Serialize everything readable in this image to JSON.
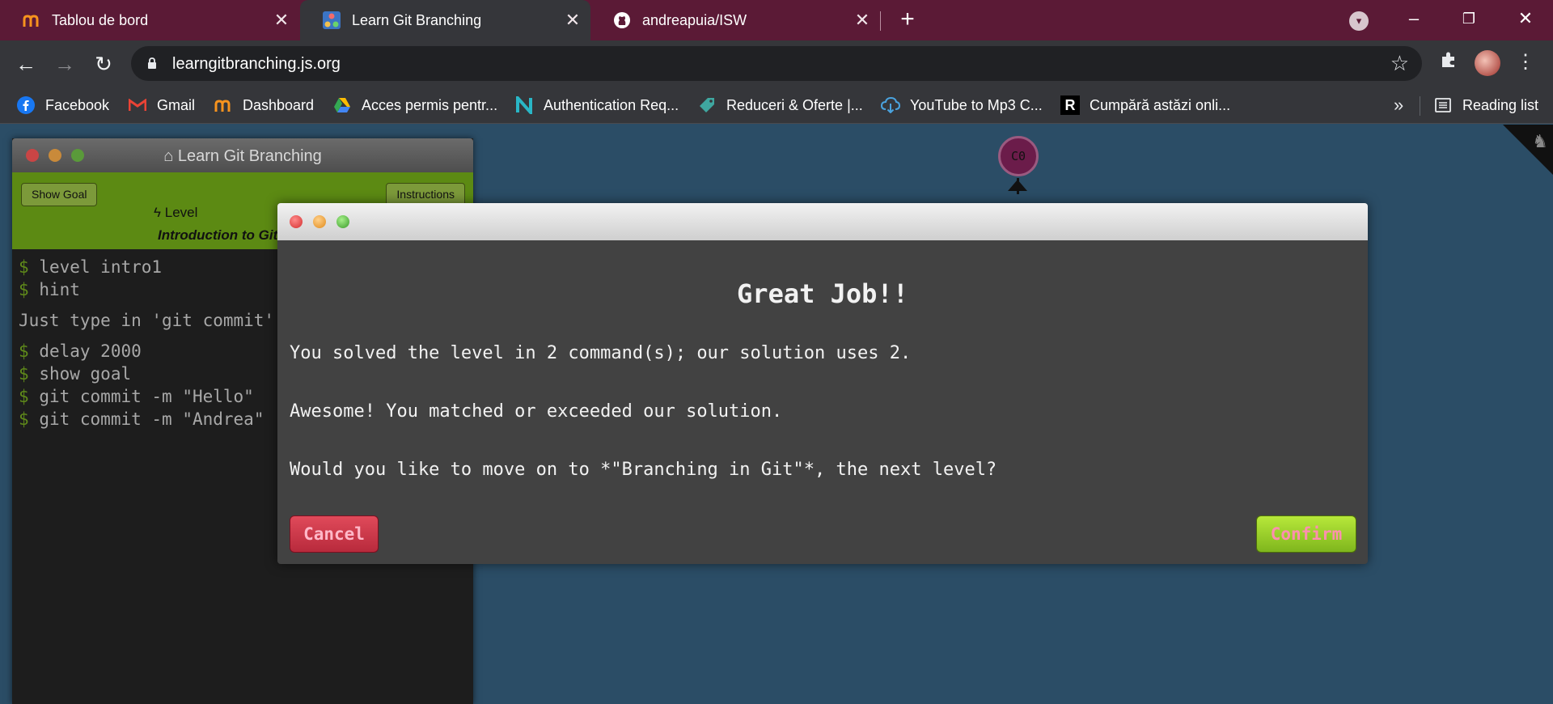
{
  "browser": {
    "tabs": [
      {
        "title": "Tablou de bord",
        "icon": "moodle-icon"
      },
      {
        "title": "Learn Git Branching",
        "icon": "learngit-icon",
        "active": true
      },
      {
        "title": "andreapuia/ISW",
        "icon": "github-icon"
      }
    ],
    "new_tab": "+",
    "tab_close": "✕",
    "url": "learngitbranching.js.org",
    "bookmarks": [
      {
        "label": "Facebook",
        "icon": "facebook-icon"
      },
      {
        "label": "Gmail",
        "icon": "gmail-icon"
      },
      {
        "label": "Dashboard",
        "icon": "moodle-icon"
      },
      {
        "label": "Acces permis pentr...",
        "icon": "google-drive-icon"
      },
      {
        "label": "Authentication Req...",
        "icon": "n-logo-icon"
      },
      {
        "label": "Reduceri & Oferte |...",
        "icon": "tag-icon"
      },
      {
        "label": "YouTube to Mp3 C...",
        "icon": "cloud-download-icon"
      },
      {
        "label": "Cumpără astăzi onli...",
        "icon": "r-logo-icon"
      }
    ],
    "more_bookmarks": "»",
    "reading_list": "Reading list"
  },
  "terminal": {
    "title": "Learn Git Branching",
    "show_goal": "Show Goal",
    "instructions": "Instructions",
    "level_prefix": "Level",
    "level_name": "Introduction to Git Commits",
    "lines": [
      {
        "prompt": "$",
        "text": "level intro1"
      },
      {
        "prompt": "$",
        "text": "hint"
      }
    ],
    "hint_text": "Just type in 'git commit' twice to finish!",
    "lines2": [
      {
        "prompt": "$",
        "text": "delay 2000"
      },
      {
        "prompt": "$",
        "text": "show goal"
      },
      {
        "prompt": "$",
        "text": "git commit -m \"Hello\""
      },
      {
        "prompt": "$",
        "text": "git commit -m \"Andrea\""
      }
    ]
  },
  "graph": {
    "node_label": "C0"
  },
  "modal": {
    "heading": "Great Job!!",
    "line1": "You solved the level in 2 command(s); our solution uses 2.",
    "line2": "Awesome! You matched or exceeded our solution.",
    "line3": "Would you like to move on to *\"Branching in Git\"*, the next level?",
    "cancel": "Cancel",
    "confirm": "Confirm"
  },
  "colors": {
    "tabstrip": "#5b1a36",
    "page_bg": "#2b4d66",
    "modal_bg": "#424242",
    "level_bar": "#5c8a13",
    "cancel": "#d23a4b",
    "confirm": "#9ed12a"
  }
}
